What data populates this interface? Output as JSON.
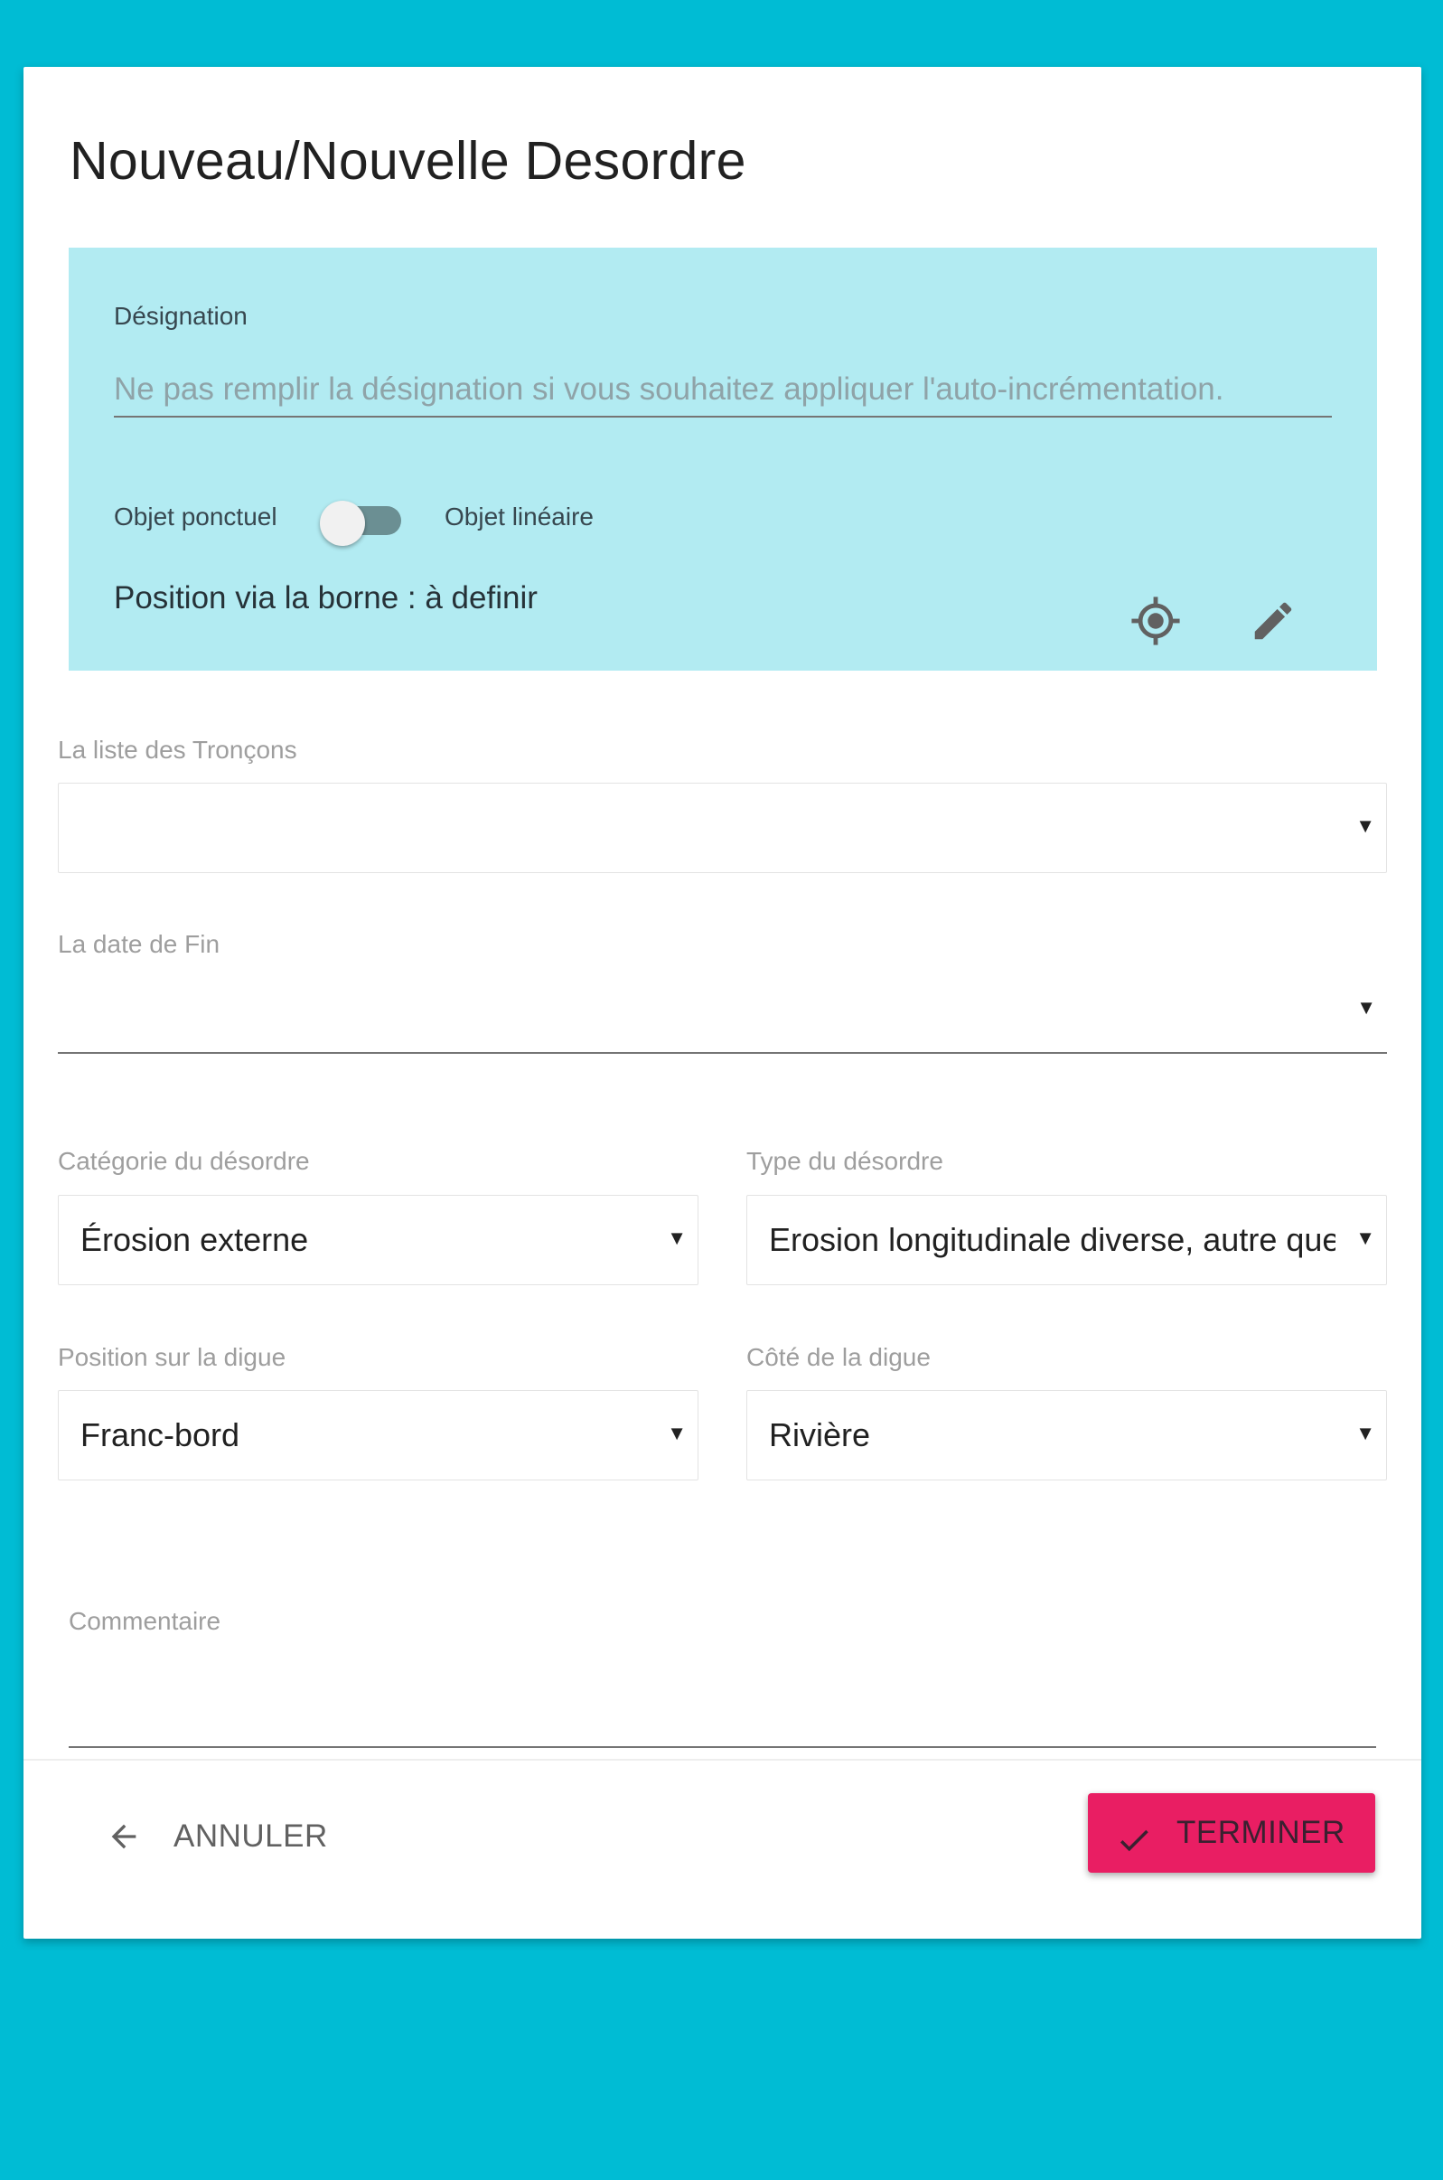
{
  "dialog": {
    "title": "Nouveau/Nouvelle Desordre"
  },
  "designation": {
    "label": "Désignation",
    "value": "",
    "placeholder": "Ne pas remplir la désignation si vous souhaitez appliquer l'auto-incrémentation."
  },
  "object_toggle": {
    "left_label": "Objet ponctuel",
    "right_label": "Objet linéaire",
    "checked": false
  },
  "position": {
    "text": "Position via la borne : à definir",
    "icons": [
      "gps-target-icon",
      "pencil-icon"
    ]
  },
  "troncons": {
    "label": "La liste des Tronçons",
    "value": ""
  },
  "date_fin": {
    "label": "La date de Fin",
    "value": ""
  },
  "categorie": {
    "label": "Catégorie du désordre",
    "value": "Érosion externe"
  },
  "type": {
    "label": "Type du désordre",
    "value": "Erosion longitudinale diverse, autre que c"
  },
  "position_digue": {
    "label": "Position sur la digue",
    "value": "Franc-bord"
  },
  "cote_digue": {
    "label": "Côté de la digue",
    "value": "Rivière"
  },
  "commentaire": {
    "label": "Commentaire",
    "value": ""
  },
  "actions": {
    "cancel_label": "ANNULER",
    "finish_label": "TERMINER"
  },
  "colors": {
    "background": "#00bcd4",
    "panel": "#b2ebf2",
    "accent": "#e91e63"
  }
}
